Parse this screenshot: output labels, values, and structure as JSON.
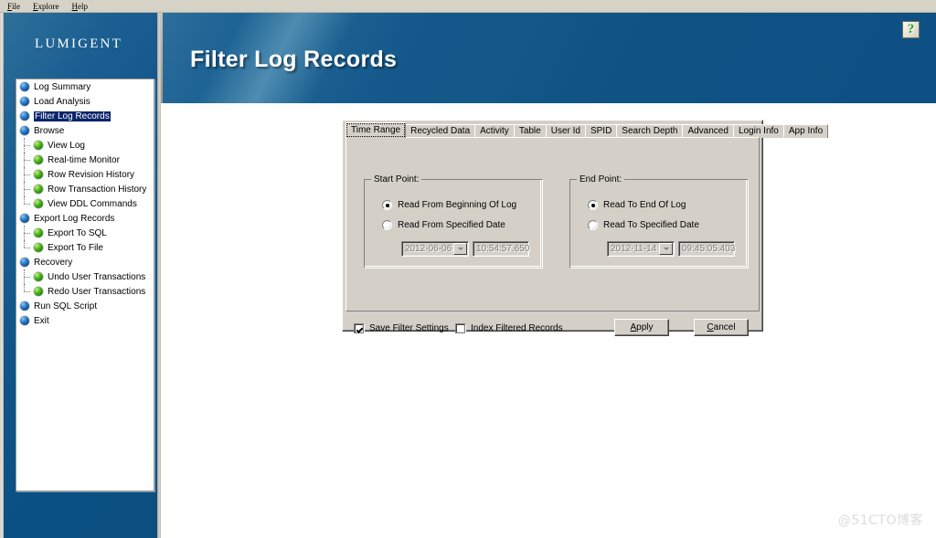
{
  "menu": {
    "items": [
      {
        "label": "File",
        "accel": "F"
      },
      {
        "label": "Explore",
        "accel": "E"
      },
      {
        "label": "Help",
        "accel": "H"
      }
    ]
  },
  "sidebar": {
    "logo": "Lumigent",
    "tree": [
      {
        "label": "Log Summary",
        "icon": "blue-node-icon",
        "level": 0,
        "selected": false
      },
      {
        "label": "Load Analysis",
        "icon": "blue-node-icon",
        "level": 0,
        "selected": false
      },
      {
        "label": "Filter Log Records",
        "icon": "blue-node-icon",
        "level": 0,
        "selected": true
      },
      {
        "label": "Browse",
        "icon": "blue-node-icon",
        "level": 0,
        "selected": false
      },
      {
        "label": "View Log",
        "icon": "green-node-icon",
        "level": 1,
        "selected": false
      },
      {
        "label": "Real-time Monitor",
        "icon": "green-node-icon",
        "level": 1,
        "selected": false
      },
      {
        "label": "Row Revision History",
        "icon": "green-node-icon",
        "level": 1,
        "selected": false
      },
      {
        "label": "Row Transaction History",
        "icon": "green-node-icon",
        "level": 1,
        "selected": false
      },
      {
        "label": "View DDL Commands",
        "icon": "green-node-icon",
        "level": 1,
        "selected": false,
        "last": true
      },
      {
        "label": "Export Log Records",
        "icon": "blue-node-icon",
        "level": 0,
        "selected": false
      },
      {
        "label": "Export To SQL",
        "icon": "green-node-icon",
        "level": 1,
        "selected": false
      },
      {
        "label": "Export To File",
        "icon": "green-node-icon",
        "level": 1,
        "selected": false,
        "last": true
      },
      {
        "label": "Recovery",
        "icon": "blue-node-icon",
        "level": 0,
        "selected": false
      },
      {
        "label": "Undo User Transactions",
        "icon": "green-node-icon",
        "level": 1,
        "selected": false
      },
      {
        "label": "Redo User Transactions",
        "icon": "green-node-icon",
        "level": 1,
        "selected": false,
        "last": true
      },
      {
        "label": "Run SQL Script",
        "icon": "blue-node-icon",
        "level": 0,
        "selected": false
      },
      {
        "label": "Exit",
        "icon": "blue-node-icon",
        "level": 0,
        "selected": false
      }
    ]
  },
  "banner": {
    "title": "Filter Log Records",
    "help_icon": "question-mark-help-icon",
    "help_glyph": "?",
    "color_start": "#2d6e9b",
    "color_end": "#0e5083"
  },
  "dialog": {
    "tabs": [
      {
        "label": "Time Range",
        "active": true
      },
      {
        "label": "Recycled Data",
        "active": false
      },
      {
        "label": "Activity",
        "active": false
      },
      {
        "label": "Table",
        "active": false
      },
      {
        "label": "User Id",
        "active": false
      },
      {
        "label": "SPID",
        "active": false
      },
      {
        "label": "Search Depth",
        "active": false
      },
      {
        "label": "Advanced",
        "active": false
      },
      {
        "label": "Login Info",
        "active": false
      },
      {
        "label": "App Info",
        "active": false
      }
    ],
    "start_point": {
      "title": "Start Point:",
      "radio_beginning": "Read From Beginning Of Log",
      "radio_specified": "Read From Specified Date",
      "date_value": "2012-06-06",
      "time_value": "10:54:57.650",
      "selected": "beginning",
      "fields_enabled": false
    },
    "end_point": {
      "title": "End Point:",
      "radio_end": "Read To End Of Log",
      "radio_specified": "Read To Specified Date",
      "date_value": "2012-11-14",
      "time_value": "09:45:05.403",
      "selected": "end",
      "fields_enabled": false
    },
    "footer": {
      "save_filter_settings": "Save Filter Settings",
      "save_filter_settings_checked": true,
      "index_filtered_records": "Index Filtered Records",
      "index_filtered_records_checked": false,
      "apply_label": "Apply",
      "apply_accel": "A",
      "cancel_label": "Cancel",
      "cancel_accel": "C"
    }
  },
  "watermark": "@51CTO博客"
}
